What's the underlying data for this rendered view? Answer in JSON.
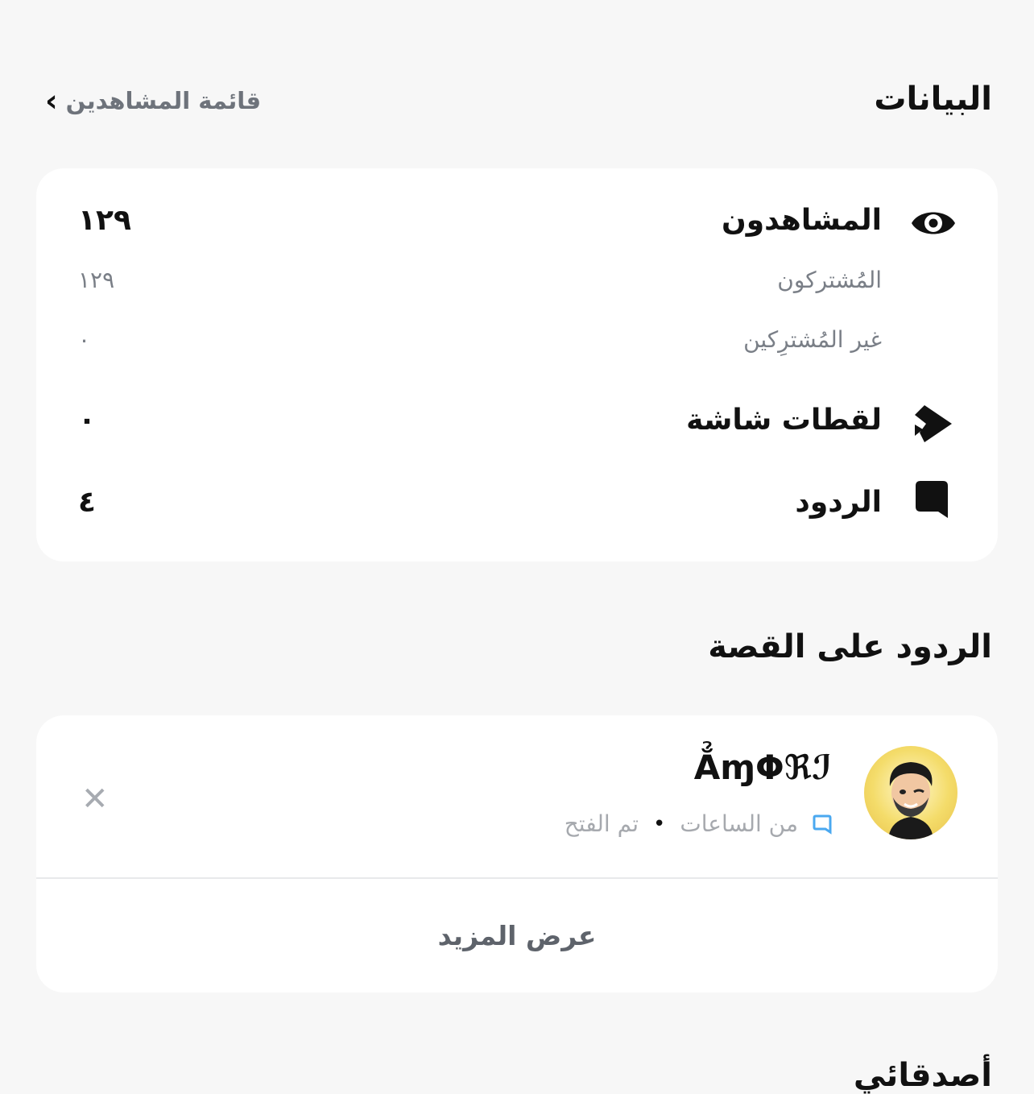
{
  "header": {
    "title": "البيانات",
    "viewers_link": "قائمة المشاهدين",
    "chevron_glyph": "‹"
  },
  "stats": {
    "viewers_label": "المشاهدون",
    "viewers_value": "١٢٩",
    "subscribers_label": "المُشتركون",
    "subscribers_value": "١٢٩",
    "non_subscribers_label": "غير المُشترِكين",
    "non_subscribers_value": "٠",
    "screenshots_label": "لقطات شاشة",
    "screenshots_value": "٠",
    "replies_label": "الردود",
    "replies_value": "٤"
  },
  "replies_section": {
    "title": "الردود على القصة",
    "reply": {
      "name": "ẲɱΦℜℐ",
      "time": "من الساعات",
      "separator": "•",
      "status": "تم الفتح",
      "close_glyph": "✕"
    },
    "show_more": "عرض المزيد"
  },
  "friends_section": {
    "title": "أصدقائي"
  },
  "colors": {
    "background": "#f7f7f7",
    "card": "#ffffff",
    "secondary_text": "#7a7f87",
    "accent_blue": "#4aa8f0"
  },
  "icons": [
    "eye-icon",
    "screenshot-icon",
    "chat-bubble-icon",
    "close-icon",
    "chevron-left-icon",
    "chat-small-icon"
  ]
}
